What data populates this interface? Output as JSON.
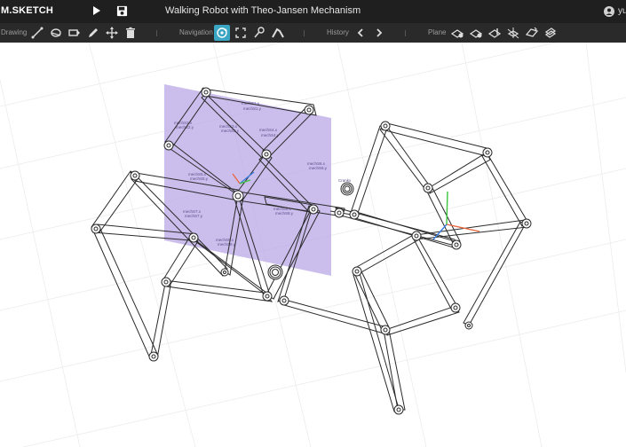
{
  "app": {
    "logo": "M.SKETCH",
    "title": "Walking Robot with Theo-Jansen Mechanism",
    "user_initials": "yu"
  },
  "toolbar": {
    "drawing_label": "Drawing",
    "navigation_label": "Navigation",
    "history_label": "History",
    "plane_label": "Plane"
  },
  "canvas": {
    "plane_color": "#b9a7e6",
    "axis_colors": {
      "x": "#e8663c",
      "y": "#3cc43c",
      "z": "#3a7be0"
    },
    "annotations": [
      "mechS1.x",
      "mechS1.y",
      "mechS2.x",
      "mechS2.y",
      "mechS3.x",
      "mechS3.y",
      "mechS4.x",
      "mechS4.y",
      "mechS5.x",
      "mechS5.y",
      "mechS6.x",
      "mechS6.y",
      "mechS7.x",
      "mechS7.y",
      "mechS8.x",
      "mechS8.y",
      "mechS9.x",
      "mechS9.y",
      "Crankx"
    ]
  }
}
